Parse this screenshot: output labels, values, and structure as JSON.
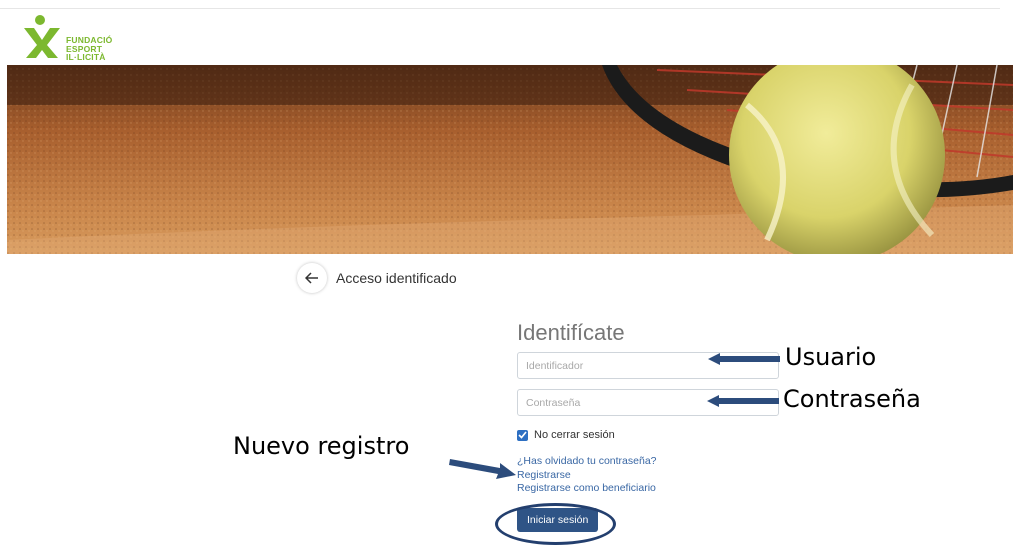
{
  "brand": {
    "logo_lines": [
      "FUNDACIÓ",
      "ESPORT",
      "IL·LICITÀ"
    ],
    "logo_color": "#7cb82f"
  },
  "header": {
    "back_icon": "arrow-left-icon",
    "title": "Acceso identificado"
  },
  "login": {
    "title": "Identifícate",
    "user_placeholder": "Identificador",
    "password_placeholder": "Contraseña",
    "remember_label": "No cerrar sesión",
    "remember_checked": true,
    "forgot_link": "¿Has olvidado tu contraseña?",
    "register_link": "Registrarse",
    "register_beneficiary_link": "Registrarse como beneficiario",
    "submit_label": "Iniciar sesión",
    "submit_color": "#2f5486",
    "link_color": "#3967a4"
  },
  "annotations": {
    "user": "Usuario",
    "password": "Contraseña",
    "new_registration": "Nuevo registro",
    "arrow_color": "#2c4c7c"
  }
}
